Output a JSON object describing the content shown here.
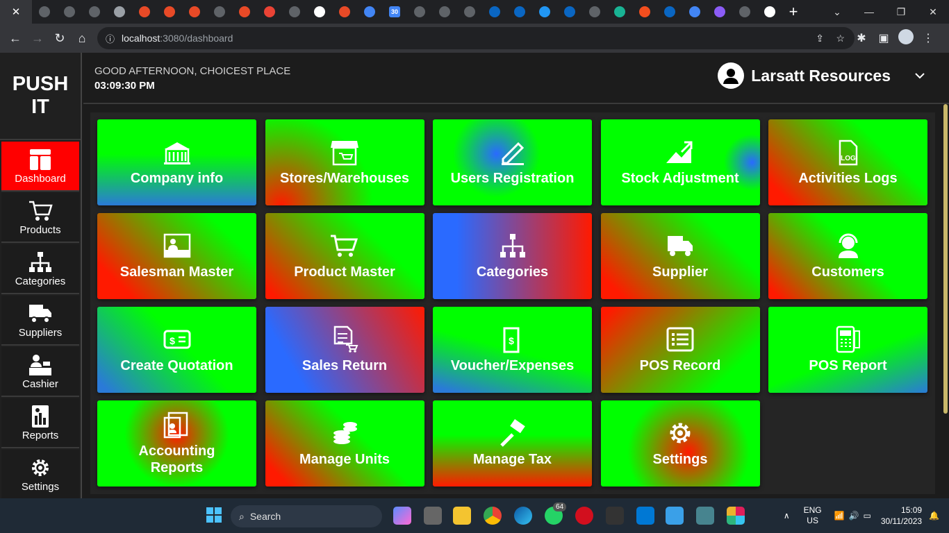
{
  "browser": {
    "address_host": "localhost",
    "address_path": ":3080/dashboard",
    "tab_badge": "30"
  },
  "app": {
    "brand": "PUSH IT",
    "greeting": "GOOD AFTERNOON, CHOICEST PLACE",
    "time": "03:09:30 PM",
    "user_name": "Larsatt Resources"
  },
  "sidebar": {
    "items": [
      {
        "label": "Dashboard",
        "icon": "dashboard-icon",
        "active": true
      },
      {
        "label": "Products",
        "icon": "cart-icon"
      },
      {
        "label": "Categories",
        "icon": "hierarchy-icon"
      },
      {
        "label": "Suppliers",
        "icon": "truck-icon"
      },
      {
        "label": "Cashier",
        "icon": "cashier-icon"
      },
      {
        "label": "Reports",
        "icon": "reports-icon"
      },
      {
        "label": "Settings",
        "icon": "gear-icon"
      }
    ]
  },
  "tiles": [
    {
      "label": "Company info",
      "icon": "building-icon"
    },
    {
      "label": "Stores/Warehouses",
      "icon": "store-icon"
    },
    {
      "label": "Users Registration",
      "icon": "pen-icon"
    },
    {
      "label": "Stock Adjustment",
      "icon": "chart-up-icon"
    },
    {
      "label": "Activities Logs",
      "icon": "log-icon"
    },
    {
      "label": "Salesman Master",
      "icon": "salesman-icon"
    },
    {
      "label": "Product Master",
      "icon": "cart-icon"
    },
    {
      "label": "Categories",
      "icon": "hierarchy-icon"
    },
    {
      "label": "Supplier",
      "icon": "truck-icon"
    },
    {
      "label": "Customers",
      "icon": "headset-icon"
    },
    {
      "label": "Create Quotation",
      "icon": "money-icon"
    },
    {
      "label": "Sales Return",
      "icon": "invoice-icon"
    },
    {
      "label": "Voucher/Expenses",
      "icon": "voucher-icon"
    },
    {
      "label": "POS Record",
      "icon": "list-icon"
    },
    {
      "label": "POS Report",
      "icon": "pos-terminal-icon"
    },
    {
      "label": "Accounting Reports",
      "icon": "report-doc-icon"
    },
    {
      "label": "Manage Units",
      "icon": "coins-icon"
    },
    {
      "label": "Manage Tax",
      "icon": "gavel-icon"
    },
    {
      "label": "Settings",
      "icon": "gear-icon"
    }
  ],
  "taskbar": {
    "search_label": "Search",
    "whatsapp_badge": "64",
    "lang_1": "ENG",
    "lang_2": "US",
    "time": "15:09",
    "date": "30/11/2023"
  }
}
